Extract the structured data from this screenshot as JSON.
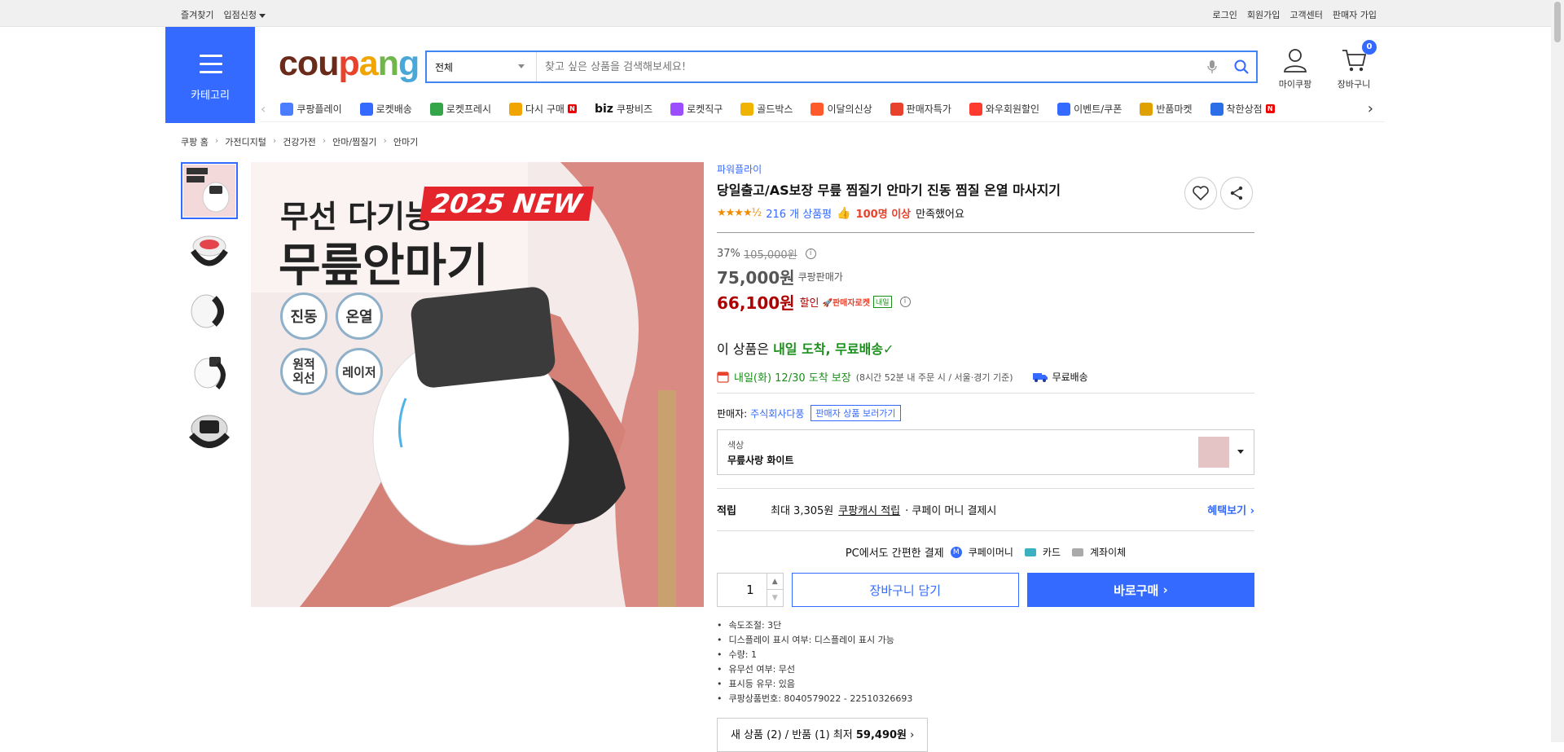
{
  "topbar": {
    "left": [
      "즐겨찾기",
      "입점신청"
    ],
    "right": [
      "로그인",
      "회원가입",
      "고객센터",
      "판매자 가입"
    ]
  },
  "header": {
    "category_label": "카테고리",
    "logo": "coupang",
    "search_scope": "전체",
    "search_placeholder": "찾고 싶은 상품을 검색해보세요!",
    "mypage_label": "마이쿠팡",
    "cart_label": "장바구니",
    "cart_count": "0"
  },
  "nav": [
    {
      "label": "쿠팡플레이",
      "icon": "play-icon",
      "color": "#4a7dff"
    },
    {
      "label": "로켓배송",
      "icon": "rocket-icon",
      "color": "#346aff"
    },
    {
      "label": "로켓프레시",
      "icon": "rocket-fresh-icon",
      "color": "#35a54a"
    },
    {
      "label": "다시 구매",
      "icon": "reorder-icon",
      "color": "#f0a500",
      "new": "N"
    },
    {
      "label": "쿠팡비즈",
      "prefix": "biz",
      "icon": "biz-icon",
      "color": "#111111"
    },
    {
      "label": "로켓직구",
      "icon": "global-icon",
      "color": "#9b4dff"
    },
    {
      "label": "골드박스",
      "icon": "goldbox-icon",
      "color": "#f0b400"
    },
    {
      "label": "이달의신상",
      "icon": "new-product-icon",
      "color": "#ff5a2c"
    },
    {
      "label": "판매자특가",
      "icon": "seller-deal-icon",
      "color": "#e8412c"
    },
    {
      "label": "와우회원할인",
      "icon": "wow-icon",
      "color": "#ff3b30"
    },
    {
      "label": "이벤트/쿠폰",
      "icon": "coupon-icon",
      "color": "#346aff"
    },
    {
      "label": "반품마켓",
      "icon": "return-market-icon",
      "color": "#e0a000"
    },
    {
      "label": "착한상점",
      "icon": "good-store-icon",
      "color": "#2c6ee8",
      "new": "N"
    }
  ],
  "breadcrumb": [
    "쿠팡 홈",
    "가전디지털",
    "건강가전",
    "안마/찜질기",
    "안마기"
  ],
  "image_text": {
    "headline": "무선 다기능",
    "new_badge": "2025 NEW",
    "product_name": "무릎안마기",
    "features": [
      "진동",
      "온열",
      "원적\n외선",
      "레이저"
    ]
  },
  "product": {
    "brand": "파워플라이",
    "title": "당일출고/AS보장 무릎 찜질기 안마기 진동 찜질 온열 마사지기",
    "rating": 4.5,
    "review_count": "216 개 상품평",
    "satisfied": "100명 이상",
    "satisfied_suffix": "만족했어요",
    "discount_rate": "37%",
    "original_price": "105,000원",
    "coupang_price": "75,000원",
    "coupang_price_label": "쿠팡판매가",
    "sale_price": "66,100원",
    "sale_label": "할인",
    "rocket_label": "판매자로켓",
    "tomorrow_tag": "내일",
    "delivery_headline_prefix": "이 상품은 ",
    "delivery_headline_green": "내일 도착, 무료배송",
    "arrival": "내일(화) 12/30 도착 보장",
    "arrival_note": "(8시간 52분 내 주문 시 / 서울·경기 기준)",
    "free_shipping": "무료배송",
    "seller_label": "판매자:",
    "seller_name": "주식회사다풍",
    "seller_link": "판매자 상품 보러가기",
    "option_label": "색상",
    "option_value": "무릎사랑 화이트",
    "reward_label": "적립",
    "reward_text": "최대 3,305원",
    "reward_link": "쿠팡캐시 적립",
    "reward_suffix": "· 쿠페이 머니 결제시",
    "benefit_link": "혜택보기",
    "pc_pay": "PC에서도 간편한 결제",
    "pay_methods": [
      "쿠페이머니",
      "카드",
      "계좌이체"
    ],
    "quantity": "1",
    "cart_button": "장바구니 담기",
    "buy_button": "바로구매",
    "specs": [
      "속도조절: 3단",
      "디스플레이 표시 여부: 디스플레이 표시 가능",
      "수량: 1",
      "유무선 여부: 무선",
      "표시등 유무: 있음",
      "쿠팡상품번호: 8040579022 - 22510326693"
    ],
    "alt_offer_prefix": "새 상품 (2) / 반품 (1) 최저",
    "alt_offer_price": "59,490원"
  }
}
